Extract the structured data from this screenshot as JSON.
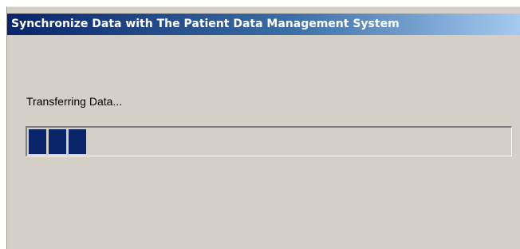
{
  "window": {
    "title": "Synchronize Data with The Patient Data Management System"
  },
  "status": {
    "text": "Transferring Data..."
  },
  "progress": {
    "fraction": 0.13,
    "fill_color": "#0a246a"
  },
  "colors": {
    "title_gradient_start": "#0a246a",
    "title_gradient_end": "#a6caf0",
    "dialog_background": "#d4d0c8"
  }
}
